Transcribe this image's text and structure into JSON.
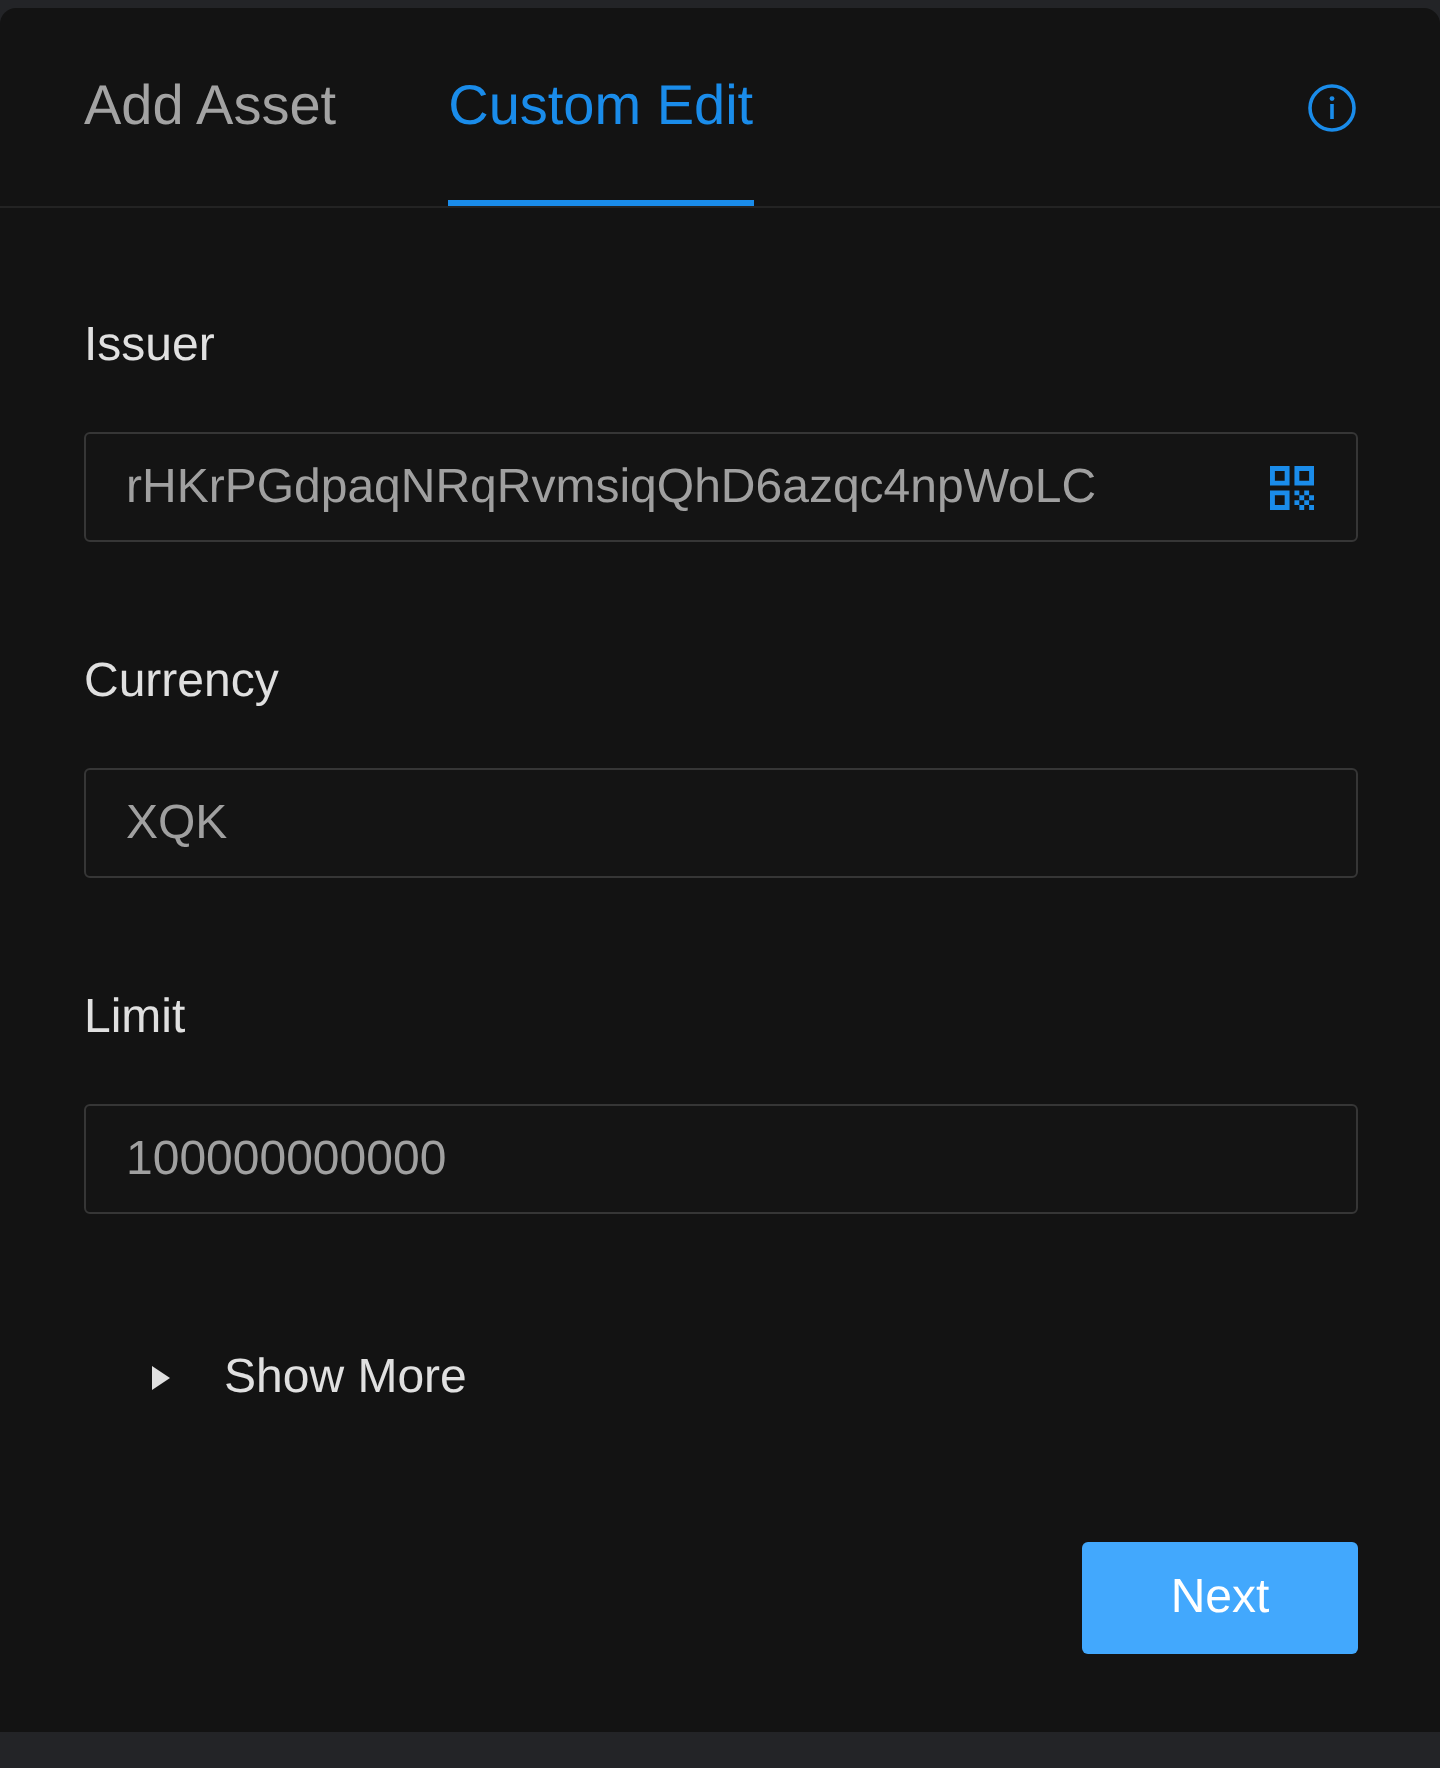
{
  "tabs": [
    {
      "label": "Add Asset",
      "selected": false
    },
    {
      "label": "Custom Edit",
      "selected": true
    }
  ],
  "fields": [
    {
      "label": "Issuer",
      "value": "rHKrPGdpaqNRqRvmsiqQhD6azqc4npWoLC",
      "kind": "scan"
    },
    {
      "label": "Currency",
      "value": "XQK",
      "kind": "plain"
    },
    {
      "label": "Limit",
      "value": "100000000000",
      "kind": "plain"
    }
  ],
  "show_more": {
    "label": "Show More",
    "expanded": false
  },
  "buttons": [
    {
      "label": "Next"
    }
  ]
}
